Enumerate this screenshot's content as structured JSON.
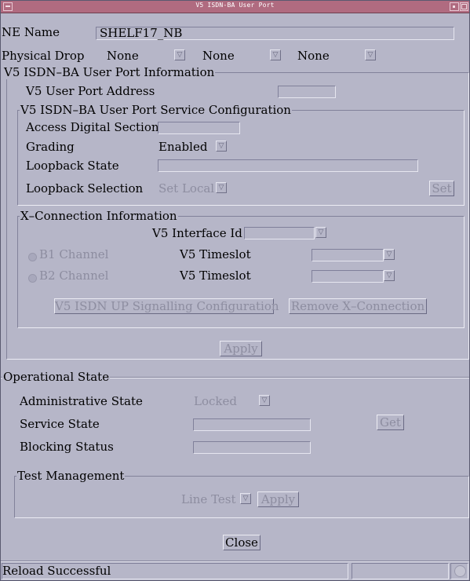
{
  "window": {
    "title": "V5 ISDN-BA User Port"
  },
  "ne_name": {
    "label": "NE Name",
    "value": "SHELF17_NB"
  },
  "physical_drop": {
    "label": "Physical Drop",
    "options": [
      "None",
      "None",
      "None"
    ]
  },
  "user_port_info": {
    "title": "V5 ISDN–BA User Port Information",
    "address_label": "V5 User Port Address",
    "address_value": ""
  },
  "service_config": {
    "title": "V5 ISDN–BA User Port Service Configuration",
    "access_digital_section_label": "Access Digital Section",
    "access_digital_section_value": "",
    "grading_label": "Grading",
    "grading_value": "Enabled",
    "loopback_state_label": "Loopback State",
    "loopback_state_value": "",
    "loopback_selection_label": "Loopback Selection",
    "loopback_selection_value": "Set Local",
    "set_button": "Set"
  },
  "xconnection": {
    "title": "X–Connection Information",
    "interface_id_label": "V5 Interface Id",
    "interface_id_value": "",
    "b1_label": "B1 Channel",
    "b2_label": "B2 Channel",
    "timeslot_label": "V5 Timeslot",
    "timeslot1_value": "",
    "timeslot2_value": "",
    "signalling_button": "V5 ISDN UP Signalling Configuration",
    "remove_button": "Remove X–Connection"
  },
  "apply_button": "Apply",
  "operational": {
    "title": "Operational State",
    "admin_label": "Administrative State",
    "admin_value": "Locked",
    "service_label": "Service State",
    "service_value": "",
    "get_button": "Get",
    "blocking_label": "Blocking Status",
    "blocking_value": ""
  },
  "test_mgmt": {
    "title": "Test Management",
    "line_test_value": "Line Test",
    "apply_button": "Apply"
  },
  "close_button": "Close",
  "status_bar": {
    "message": "Reload Successful"
  },
  "icons": {
    "menu": "window-menu-icon",
    "minimize": "minimize-icon",
    "maximize": "maximize-icon",
    "status": "status-light-icon"
  }
}
